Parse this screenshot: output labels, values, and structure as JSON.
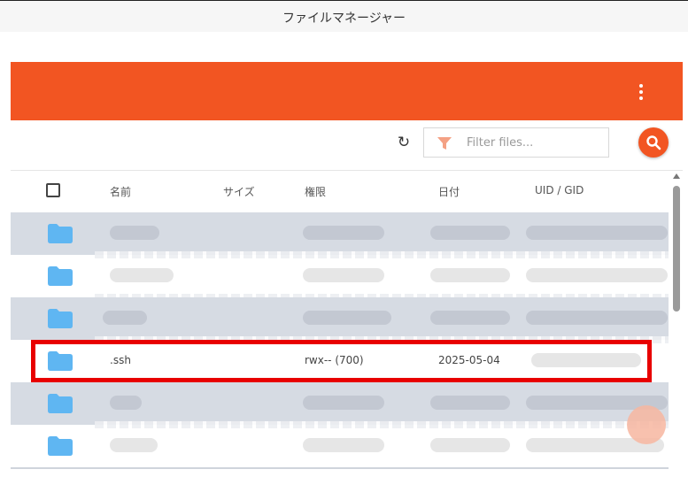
{
  "window": {
    "title": "ファイルマネージャー"
  },
  "toolbar": {
    "filter_placeholder": "Filter files...",
    "refresh_icon": "refresh-icon",
    "search_icon": "search-icon",
    "filter_icon": "filter-icon",
    "menu_icon": "more-vert-icon"
  },
  "table": {
    "headers": {
      "name": "名前",
      "size": "サイズ",
      "permissions": "権限",
      "date": "日付",
      "owner": "UID / GID"
    },
    "highlighted_row": {
      "name": ".ssh",
      "permissions": "rwx-- (700)",
      "date": "2025-05-04"
    }
  },
  "colors": {
    "accent": "#f25522",
    "folder": "#5fb6f2",
    "highlight_border": "#e80000",
    "alt_row": "#d6dbe3"
  }
}
